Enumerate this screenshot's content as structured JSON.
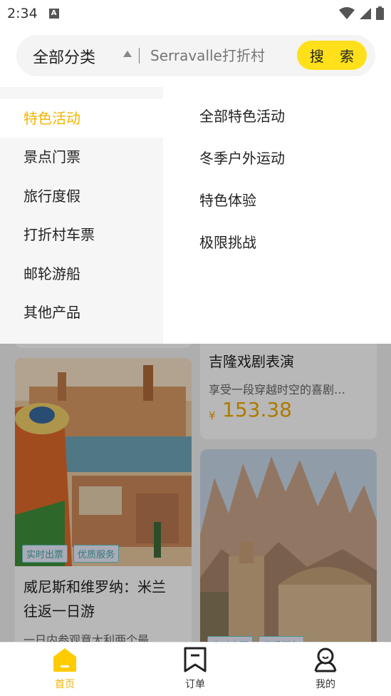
{
  "status": {
    "time": "2:34",
    "notif_icon": "A"
  },
  "search": {
    "category_label": "全部分类",
    "placeholder": "Serravalle打折村",
    "button_label": "搜 索"
  },
  "dropdown": {
    "categories": [
      {
        "label": "特色活动",
        "active": true
      },
      {
        "label": "景点门票",
        "active": false
      },
      {
        "label": "旅行度假",
        "active": false
      },
      {
        "label": "打折村车票",
        "active": false
      },
      {
        "label": "邮轮游船",
        "active": false
      },
      {
        "label": "其他产品",
        "active": false
      }
    ],
    "subcategories": [
      "全部特色活动",
      "冬季户外运动",
      "特色体验",
      "极限挑战"
    ]
  },
  "cards": {
    "left": {
      "tags": [
        "实时出票",
        "优质服务"
      ],
      "title_line1": "威尼斯和维罗纳：米兰",
      "title_line2": "往返一日游",
      "subtitle": "一日内参观意大利两个最…"
    },
    "right_top": {
      "title": "吉隆戏剧表演",
      "subtitle": "享受一段穿越时空的喜剧…",
      "currency": "¥",
      "price": "153.38"
    },
    "right_bottom": {
      "tags": [
        "实时出票",
        "优质服务"
      ]
    }
  },
  "nav": {
    "items": [
      {
        "label": "首页",
        "icon": "home-icon",
        "active": true
      },
      {
        "label": "订单",
        "icon": "bookmark-icon",
        "active": false
      },
      {
        "label": "我的",
        "icon": "profile-icon",
        "active": false
      }
    ]
  },
  "colors": {
    "accent": "#ffe01a",
    "accent_text": "#f2b400"
  }
}
